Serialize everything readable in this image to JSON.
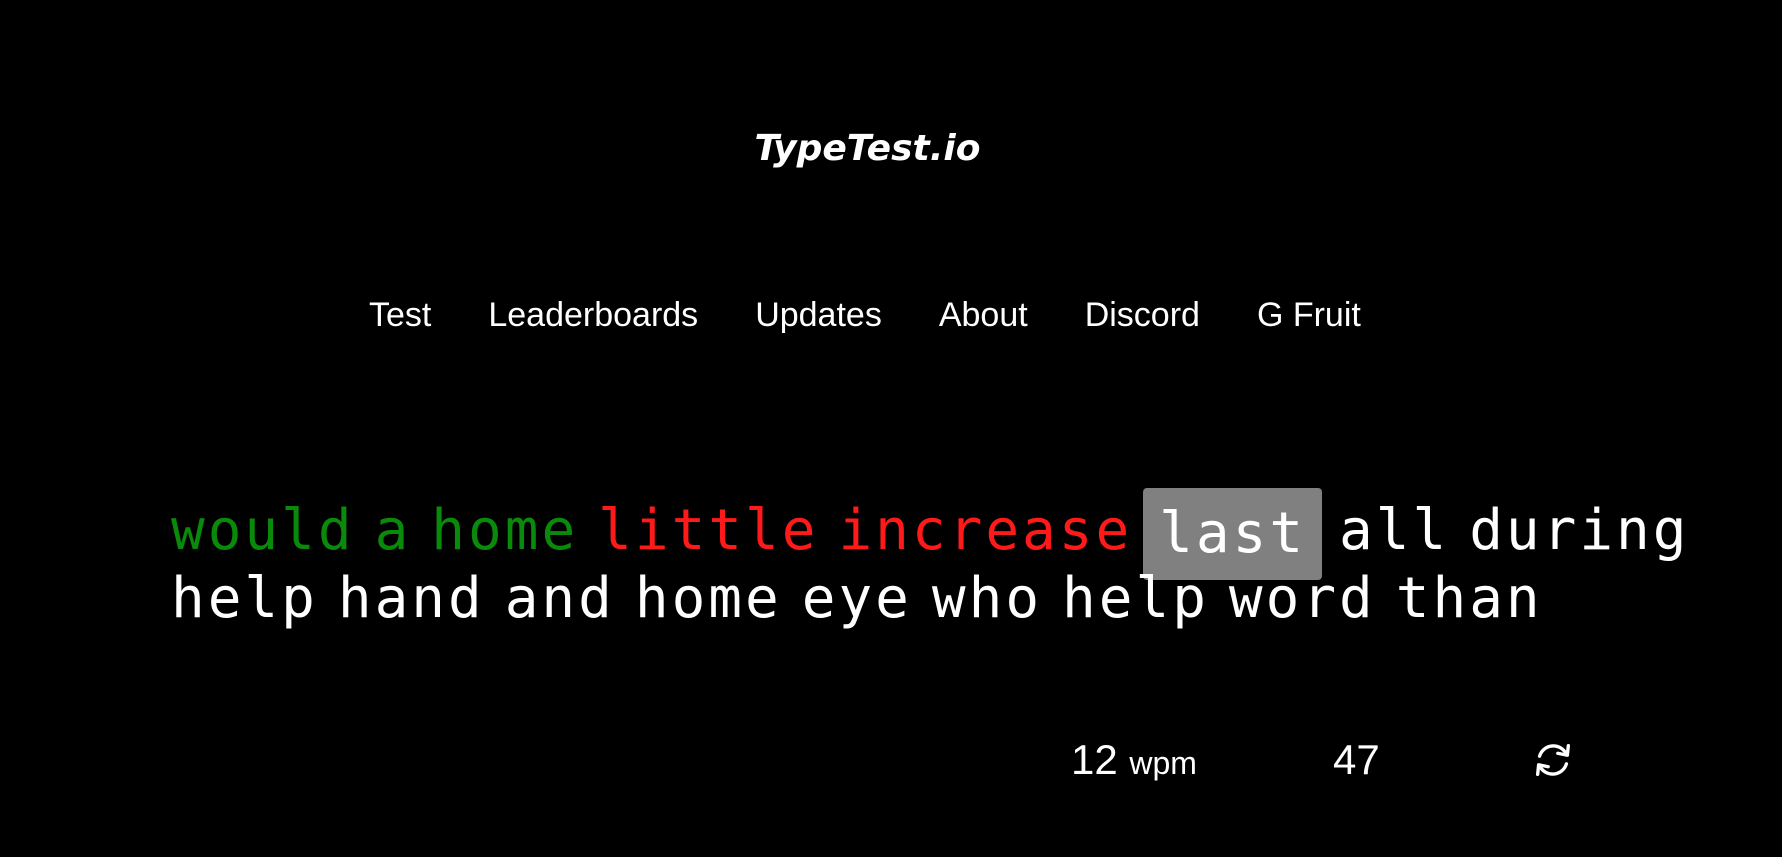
{
  "header": {
    "logo_text": "TypeTest.io"
  },
  "nav": {
    "items": [
      {
        "label": "Test"
      },
      {
        "label": "Leaderboards"
      },
      {
        "label": "Updates"
      },
      {
        "label": "About"
      },
      {
        "label": "Discord"
      },
      {
        "label": "G Fruit"
      }
    ]
  },
  "typing": {
    "lines": [
      [
        {
          "text": "would",
          "state": "correct"
        },
        {
          "text": "a",
          "state": "correct"
        },
        {
          "text": "home",
          "state": "correct"
        },
        {
          "text": "little",
          "state": "incorrect"
        },
        {
          "text": "increase",
          "state": "incorrect"
        },
        {
          "text": "last",
          "state": "current"
        },
        {
          "text": "all",
          "state": "pending"
        },
        {
          "text": "during",
          "state": "pending"
        }
      ],
      [
        {
          "text": "help",
          "state": "pending"
        },
        {
          "text": "hand",
          "state": "pending"
        },
        {
          "text": "and",
          "state": "pending"
        },
        {
          "text": "home",
          "state": "pending"
        },
        {
          "text": "eye",
          "state": "pending"
        },
        {
          "text": "who",
          "state": "pending"
        },
        {
          "text": "help",
          "state": "pending"
        },
        {
          "text": "word",
          "state": "pending"
        },
        {
          "text": "than",
          "state": "pending"
        }
      ]
    ]
  },
  "stats": {
    "wpm_value": "12",
    "wpm_unit": "wpm",
    "timer": "47",
    "restart_icon": "restart-icon"
  },
  "colors": {
    "background": "#000000",
    "correct": "#0a8a0a",
    "incorrect": "#ff1a1a",
    "pending": "#ffffff",
    "current_highlight": "#808080"
  }
}
